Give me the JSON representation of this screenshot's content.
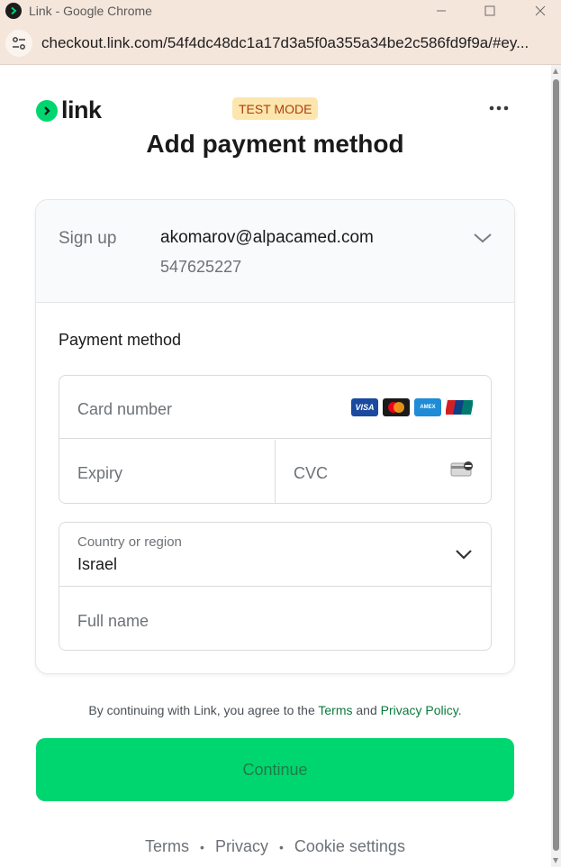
{
  "window": {
    "title": "Link - Google Chrome",
    "url": "checkout.link.com/54f4dc48dc1a17d3a5f0a355a34be2c586fd9f9a/#ey..."
  },
  "header": {
    "logo_text": "link",
    "badge": "TEST MODE",
    "title": "Add payment method"
  },
  "signup": {
    "label": "Sign up",
    "email": "akomarov@alpacamed.com",
    "phone": "547625227"
  },
  "payment": {
    "heading": "Payment method",
    "card_number_placeholder": "Card number",
    "expiry_placeholder": "Expiry",
    "cvc_placeholder": "CVC",
    "brands": [
      "VISA",
      "mastercard",
      "AMEX",
      "UnionPay"
    ]
  },
  "address": {
    "country_label": "Country or region",
    "country_value": "Israel",
    "full_name_placeholder": "Full name"
  },
  "consent": {
    "prefix": "By continuing with Link, you agree to the ",
    "terms": "Terms",
    "and": " and ",
    "privacy": "Privacy Policy",
    "suffix": "."
  },
  "continue_label": "Continue",
  "footer": {
    "terms": "Terms",
    "privacy": "Privacy",
    "cookie": "Cookie settings",
    "separator": "•"
  },
  "colors": {
    "link_green": "#00d66f",
    "badge_bg": "#fde5ae",
    "badge_text": "#a8410f",
    "chrome_frame": "#f5e6dc"
  },
  "icons": {
    "app": "link-app-icon",
    "site_info": "tune-icon",
    "more": "more-horizontal-icon",
    "chevron": "chevron-down-icon",
    "cvc": "card-back-icon"
  }
}
